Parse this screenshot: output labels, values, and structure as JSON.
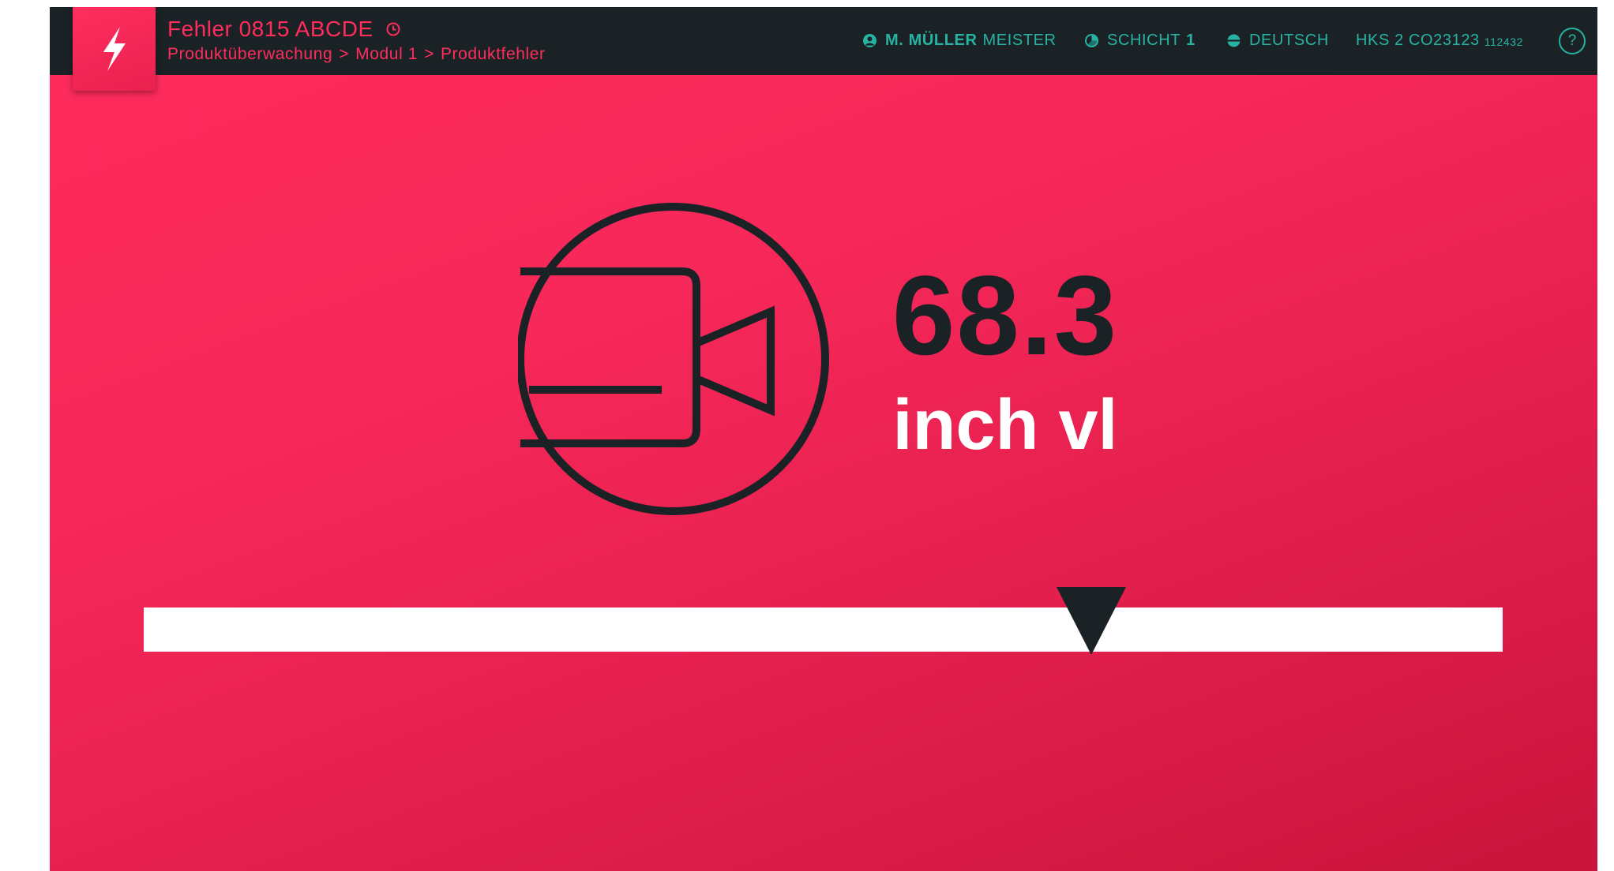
{
  "header": {
    "title": "Fehler 0815 ABCDE",
    "breadcrumb": {
      "items": [
        "Produktüberwachung",
        "Modul 1",
        "Produktfehler"
      ],
      "separator": ">"
    }
  },
  "status": {
    "user": {
      "name": "M. MÜLLER",
      "role": "MEISTER",
      "icon": "user-icon"
    },
    "shift": {
      "label": "SCHICHT",
      "value": "1",
      "icon": "pie-chart-icon"
    },
    "language": {
      "label": "DEUTSCH",
      "icon": "globe-icon"
    },
    "device": {
      "label": "HKS 2 CO23123",
      "code": "112432"
    },
    "help": "?"
  },
  "main": {
    "icon": "video-camera-icon",
    "value": "68.3",
    "unit": "inch vl",
    "gauge_level": 0.697
  },
  "colors": {
    "accent": "#ff2c5c",
    "dark": "#1b2226",
    "status_text": "#27b3a4",
    "gauge_bar": "#ffffff"
  }
}
